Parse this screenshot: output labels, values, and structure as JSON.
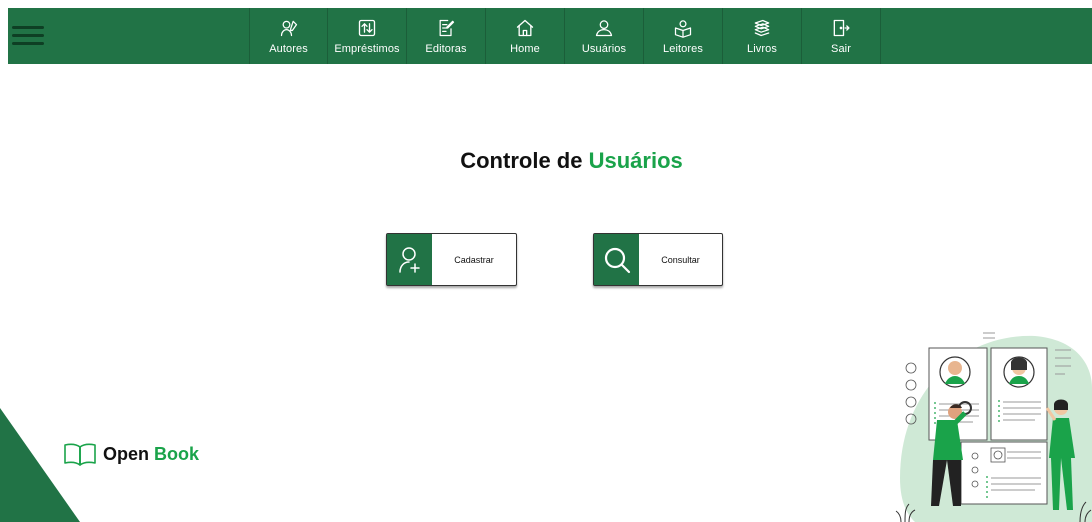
{
  "nav": {
    "items": [
      {
        "label": "Autores",
        "icon": "author-icon"
      },
      {
        "label": "Empréstimos",
        "icon": "swap-icon"
      },
      {
        "label": "Editoras",
        "icon": "edit-document-icon"
      },
      {
        "label": "Home",
        "icon": "home-icon"
      },
      {
        "label": "Usuários",
        "icon": "user-icon"
      },
      {
        "label": "Leitores",
        "icon": "reader-icon"
      },
      {
        "label": "Livros",
        "icon": "books-icon"
      },
      {
        "label": "Sair",
        "icon": "exit-icon"
      }
    ]
  },
  "page": {
    "title_prefix": "Controle de",
    "title_accent": "Usuários"
  },
  "actions": {
    "cadastrar": {
      "label": "Cadastrar",
      "icon": "add-user-icon"
    },
    "consultar": {
      "label": "Consultar",
      "icon": "search-icon"
    }
  },
  "brand": {
    "name_prefix": "Open",
    "name_accent": "Book",
    "icon": "open-book-icon"
  },
  "colors": {
    "primary": "#217346",
    "accent": "#1aa34a",
    "text": "#111111",
    "background": "#ffffff"
  }
}
